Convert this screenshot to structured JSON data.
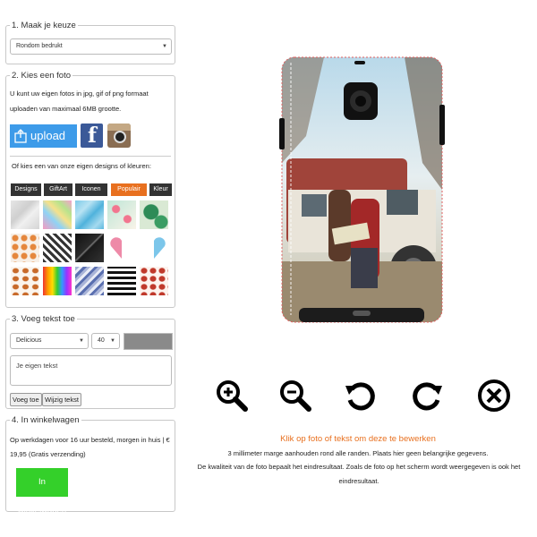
{
  "step1": {
    "legend": "1. Maak je keuze",
    "select_value": "Rondom bedrukt"
  },
  "step2": {
    "legend": "2. Kies een foto",
    "intro": "U kunt uw eigen fotos in jpg, gif of png formaat uploaden van maximaal 6MB grootte.",
    "upload_label": "upload",
    "designs_text": "Of kies een van onze eigen designs of kleuren:",
    "tabs": [
      "Designs",
      "GiftArt",
      "Iconen",
      "Populair",
      "Kleur"
    ],
    "active_tab": "Populair"
  },
  "step3": {
    "legend": "3. Voeg tekst toe",
    "font_value": "Delicious",
    "size_value": "40",
    "text_placeholder": "Je eigen tekst",
    "add_label": "Voeg toe",
    "edit_label": "Wijzig tekst"
  },
  "step4": {
    "legend": "4. In winkelwagen",
    "shipping_text": "Op werkdagen voor 16 uur besteld, morgen in huis | € 19,95 (Gratis verzending)",
    "cart_label": "In winkelwagen"
  },
  "info": {
    "click_hint": "Klik op foto of tekst om deze te bewerken",
    "margin_note": "3 millimeter marge aanhouden rond alle randen. Plaats hier geen belangrijke gegevens.",
    "quality_note": "De kwaliteit van de foto bepaalt het eindresultaat. Zoals de foto op het scherm wordt weergegeven is ook het eindresultaat."
  },
  "colors": {
    "accent_orange": "#e8701f",
    "cart_green": "#34d02a",
    "upload_blue": "#3d9be9",
    "facebook_blue": "#3b5998"
  },
  "tools": [
    "zoom-in-icon",
    "zoom-out-icon",
    "rotate-left-icon",
    "rotate-right-icon",
    "close-icon"
  ]
}
